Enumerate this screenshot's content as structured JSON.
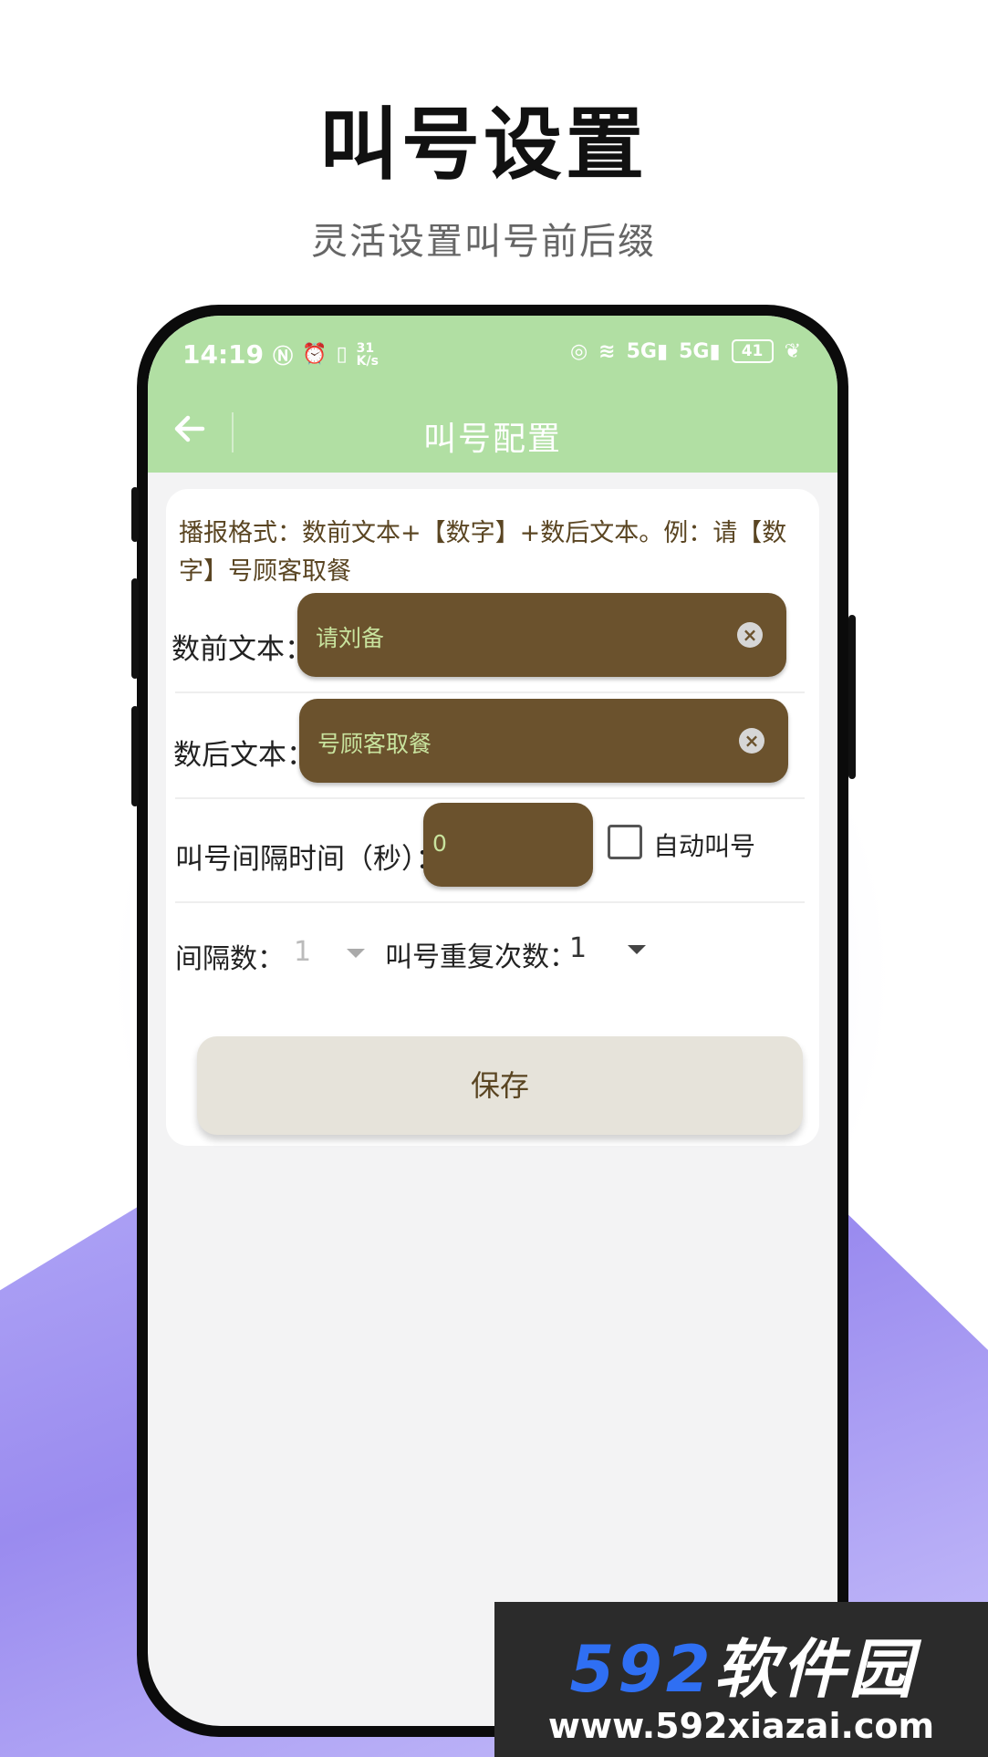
{
  "hero": {
    "title": "叫号设置",
    "subtitle": "灵活设置叫号前后缀"
  },
  "status_bar": {
    "time": "14:19",
    "net_speed": "31 K/s",
    "battery": "41",
    "left_icons": [
      "nfc-icon",
      "alarm-icon",
      "vibrate-icon"
    ],
    "right_icons": [
      "hotspot-icon",
      "wifi-icon",
      "signal-5g-icon",
      "signal-5g-icon",
      "battery-icon",
      "leaf-icon"
    ]
  },
  "appbar": {
    "title": "叫号配置",
    "back_icon": "arrow-left-icon",
    "color": "#b1dfa3"
  },
  "form": {
    "format_note": "播报格式：数前文本+【数字】+数后文本。例：请【数字】号顾客取餐",
    "prefix": {
      "label": "数前文本：",
      "value": "请刘备"
    },
    "suffix": {
      "label": "数后文本：",
      "value": "号顾客取餐"
    },
    "interval_time": {
      "label": "叫号间隔时间（秒）：",
      "value": "0"
    },
    "auto_call": {
      "label": "自动叫号",
      "checked": false
    },
    "interval_count": {
      "label": "间隔数：",
      "value": "1"
    },
    "repeat_count": {
      "label": "叫号重复次数：",
      "value": "1"
    },
    "save_label": "保存",
    "input_color": "#6b522d"
  },
  "watermark": {
    "logo_num": "592",
    "logo_text": "软件园",
    "url": "www.592xiazai.com"
  }
}
